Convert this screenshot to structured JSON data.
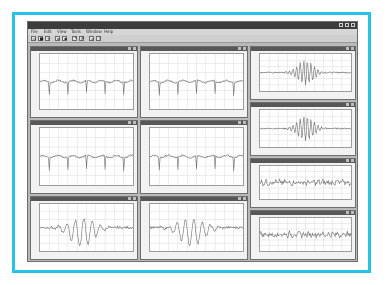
{
  "app": {
    "title": "",
    "menus": [
      "File",
      "Edit",
      "View",
      "Tools",
      "Window",
      "Help"
    ],
    "toolbar_icons": [
      "open-file-icon",
      "save-icon",
      "zoom-icon",
      "play-icon",
      "stop-icon",
      "settings-icon",
      "grid-icon",
      "print-icon",
      "help-icon"
    ]
  },
  "colors": {
    "frame_border": "#25c3e8",
    "window_bg": "#b9b9b9",
    "panel_header": "#575757",
    "plot_line": "#6f6f6f"
  },
  "panels": [
    {
      "id": "p1",
      "kind": "spikes",
      "title": "",
      "xlabel": ""
    },
    {
      "id": "p2",
      "kind": "spikes",
      "title": "",
      "xlabel": ""
    },
    {
      "id": "p3",
      "kind": "burst",
      "title": "",
      "xlabel": ""
    },
    {
      "id": "p4",
      "kind": "spikes",
      "title": "",
      "xlabel": ""
    },
    {
      "id": "p5",
      "kind": "spikes",
      "title": "",
      "xlabel": ""
    },
    {
      "id": "p6",
      "kind": "burst",
      "title": "",
      "xlabel": ""
    },
    {
      "id": "p7",
      "kind": "wave",
      "title": "",
      "xlabel": ""
    },
    {
      "id": "p8",
      "kind": "wave",
      "title": "",
      "xlabel": ""
    },
    {
      "id": "p9",
      "kind": "noise",
      "title": "",
      "xlabel": ""
    },
    {
      "id": "p10",
      "kind": "noise",
      "title": "",
      "xlabel": ""
    }
  ]
}
